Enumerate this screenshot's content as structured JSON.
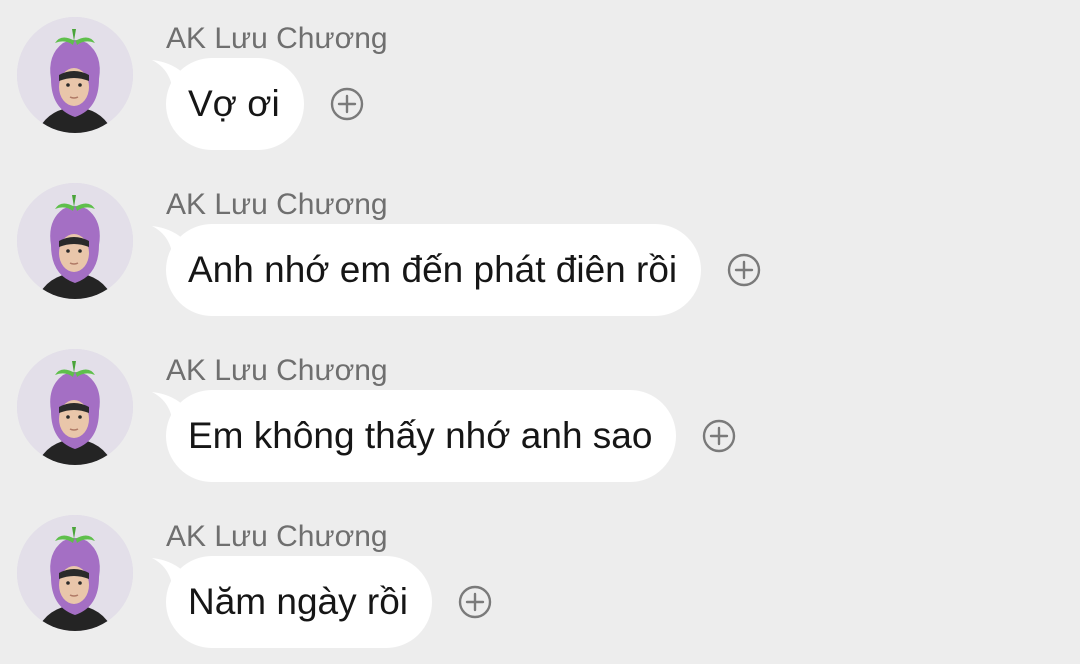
{
  "messages": [
    {
      "sender": "AK Lưu Chương",
      "text": "Vợ ơi"
    },
    {
      "sender": "AK Lưu Chương",
      "text": "Anh nhớ em đến phát điên rồi"
    },
    {
      "sender": "AK Lưu Chương",
      "text": "Em không thấy nhớ anh sao"
    },
    {
      "sender": "AK Lưu Chương",
      "text": "Năm ngày rồi"
    }
  ],
  "icons": {
    "avatar": "eggplant-hat-avatar",
    "reaction": "add-reaction-icon"
  },
  "colors": {
    "background": "#ededed",
    "bubble": "#ffffff",
    "sender_text": "#6f6f6f",
    "message_text": "#161616",
    "icon": "#7a7a7a"
  }
}
